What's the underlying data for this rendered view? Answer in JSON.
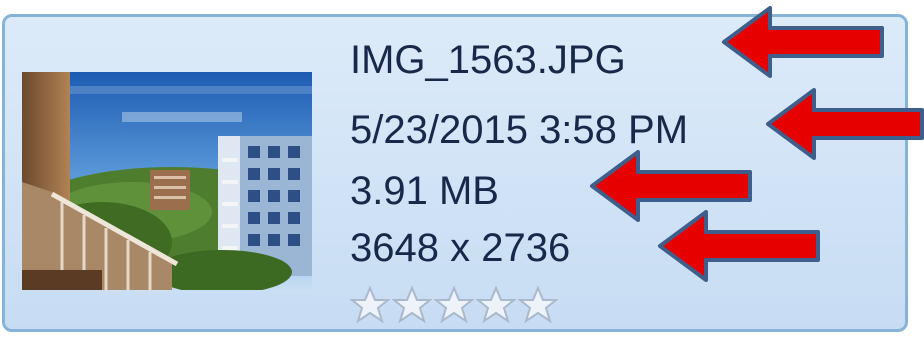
{
  "file": {
    "name": "IMG_1563.JPG",
    "date_taken": "5/23/2015 3:58 PM",
    "size": "3.91 MB",
    "dimensions": "3648 x 2736"
  },
  "rating": {
    "value": 0,
    "max": 5
  },
  "thumbnail": {
    "icon": "image-thumbnail"
  },
  "annotations": {
    "arrow_color": "#e60000",
    "arrow_outline": "#3e5f8c"
  },
  "colors": {
    "panel_background": "#d3e5f7",
    "panel_border": "#86b3d8",
    "text": "#17284a"
  }
}
